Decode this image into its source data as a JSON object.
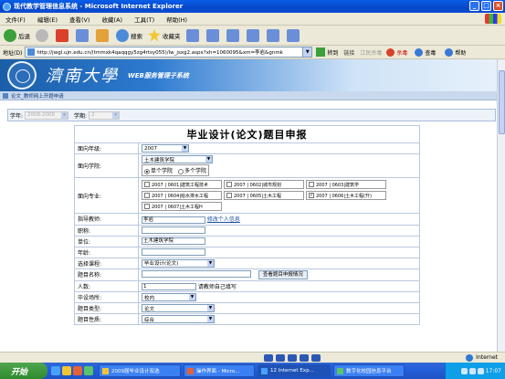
{
  "window": {
    "title": "现代教学管理信息系统 - Microsoft Internet Explorer"
  },
  "menu": [
    "文件(F)",
    "编辑(E)",
    "查看(V)",
    "收藏(A)",
    "工具(T)",
    "帮助(H)"
  ],
  "toolbar": {
    "back": "后退",
    "search": "搜索",
    "favorites": "收藏夹"
  },
  "address": {
    "label": "地址(D)",
    "url": "http://jwgl.ujn.edu.cn/(tmmxk4qaqqgy5zg4rtsy055)/lw_jsxg2.aspx?xh=1060095&xm=李岩&gnmk",
    "go": "转到",
    "links": "链接",
    "seg1": "江民杀毒",
    "kill": "杀毒",
    "check": "查毒",
    "help": "帮助"
  },
  "header": {
    "brand": "濟南大學",
    "system": "WEB服务管理子系统"
  },
  "breadcrumb": "论文_教师网上开题申请",
  "filters": {
    "year_label": "学年:",
    "year_value": "2008-2009",
    "term_label": "学期:",
    "term_value": "2"
  },
  "form": {
    "title": "毕业设计(论文)题目申报",
    "grade_label": "面向年级:",
    "grade_value": "2007",
    "college_label": "面向学院:",
    "college_value": "土木建筑学院",
    "college_single": "单个学院",
    "college_multi": "多个学院",
    "major_label": "面向专业:",
    "majors": [
      {
        "text": "2007 | 0601|建筑工程技术",
        "checked": false
      },
      {
        "text": "2007 | 0602|城市规划",
        "checked": false
      },
      {
        "text": "2007 | 0603|建筑学",
        "checked": false
      },
      {
        "text": "2007 | 0604|给水排水工程",
        "checked": false
      },
      {
        "text": "2007 | 0605|土木工程",
        "checked": false
      },
      {
        "text": "2007 | 0606|土木工程(升)",
        "checked": true
      },
      {
        "text": "2007 | 0607|土木工程H",
        "checked": false
      }
    ],
    "advisor_label": "指导教师:",
    "advisor_value": "李岩",
    "modify_link": "修改个人信息",
    "title_rank_label": "职称:",
    "title_rank_value": "",
    "unit_label": "单位:",
    "unit_value": "土木建筑学院",
    "age_label": "年龄:",
    "age_value": "",
    "course_label": "选择课程:",
    "course_value": "毕业设计(论文)",
    "topic_label": "题目名称:",
    "topic_value": "",
    "check_button": "查看题目申报情况",
    "people_label": "人数:",
    "people_value": "1",
    "people_hint": "请教师自己填写",
    "place_label": "毕设场所:",
    "place_value": "校内",
    "type_label": "题目类型:",
    "type_value": "论文",
    "nature_label": "题目性质:",
    "nature_value": "综合"
  },
  "status": {
    "zone": "Internet"
  },
  "taskbar": {
    "start": "开始",
    "tasks": [
      "2009届毕业设计双选",
      "操作界面 - Micro...",
      "12 Internet Exp...",
      "数字化校园信息平台"
    ],
    "clock": "17:07"
  }
}
